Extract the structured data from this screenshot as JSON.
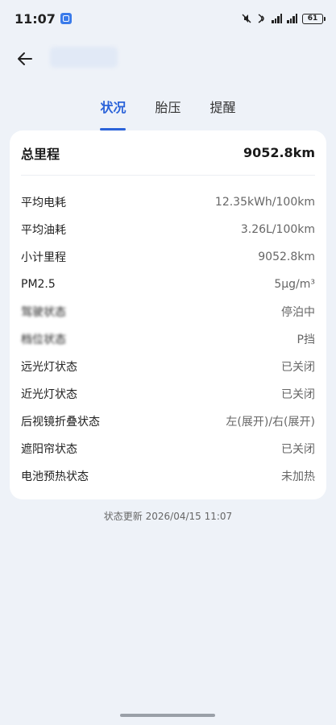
{
  "status_bar": {
    "time": "11:07",
    "battery": "61"
  },
  "tabs": [
    {
      "label": "状况",
      "active": true
    },
    {
      "label": "胎压",
      "active": false
    },
    {
      "label": "提醒",
      "active": false
    }
  ],
  "card": {
    "total_label": "总里程",
    "total_value": "9052.8km",
    "rows": [
      {
        "label": "平均电耗",
        "value": "12.35kWh/100km"
      },
      {
        "label": "平均油耗",
        "value": "3.26L/100km"
      },
      {
        "label": "小计里程",
        "value": "9052.8km"
      },
      {
        "label": "PM2.5",
        "value": "5μg/m³"
      },
      {
        "label": "驾驶状态",
        "value": "停泊中"
      },
      {
        "label": "档位状态",
        "value": "P挡"
      },
      {
        "label": "远光灯状态",
        "value": "已关闭"
      },
      {
        "label": "近光灯状态",
        "value": "已关闭"
      },
      {
        "label": "后视镜折叠状态",
        "value": "左(展开)/右(展开)"
      },
      {
        "label": "遮阳帘状态",
        "value": "已关闭"
      },
      {
        "label": "电池预热状态",
        "value": "未加热"
      }
    ]
  },
  "update_time": "状态更新 2026/04/15 11:07",
  "colors": {
    "accent": "#2b63d9",
    "background": "#eef2f8",
    "card": "#ffffff"
  }
}
